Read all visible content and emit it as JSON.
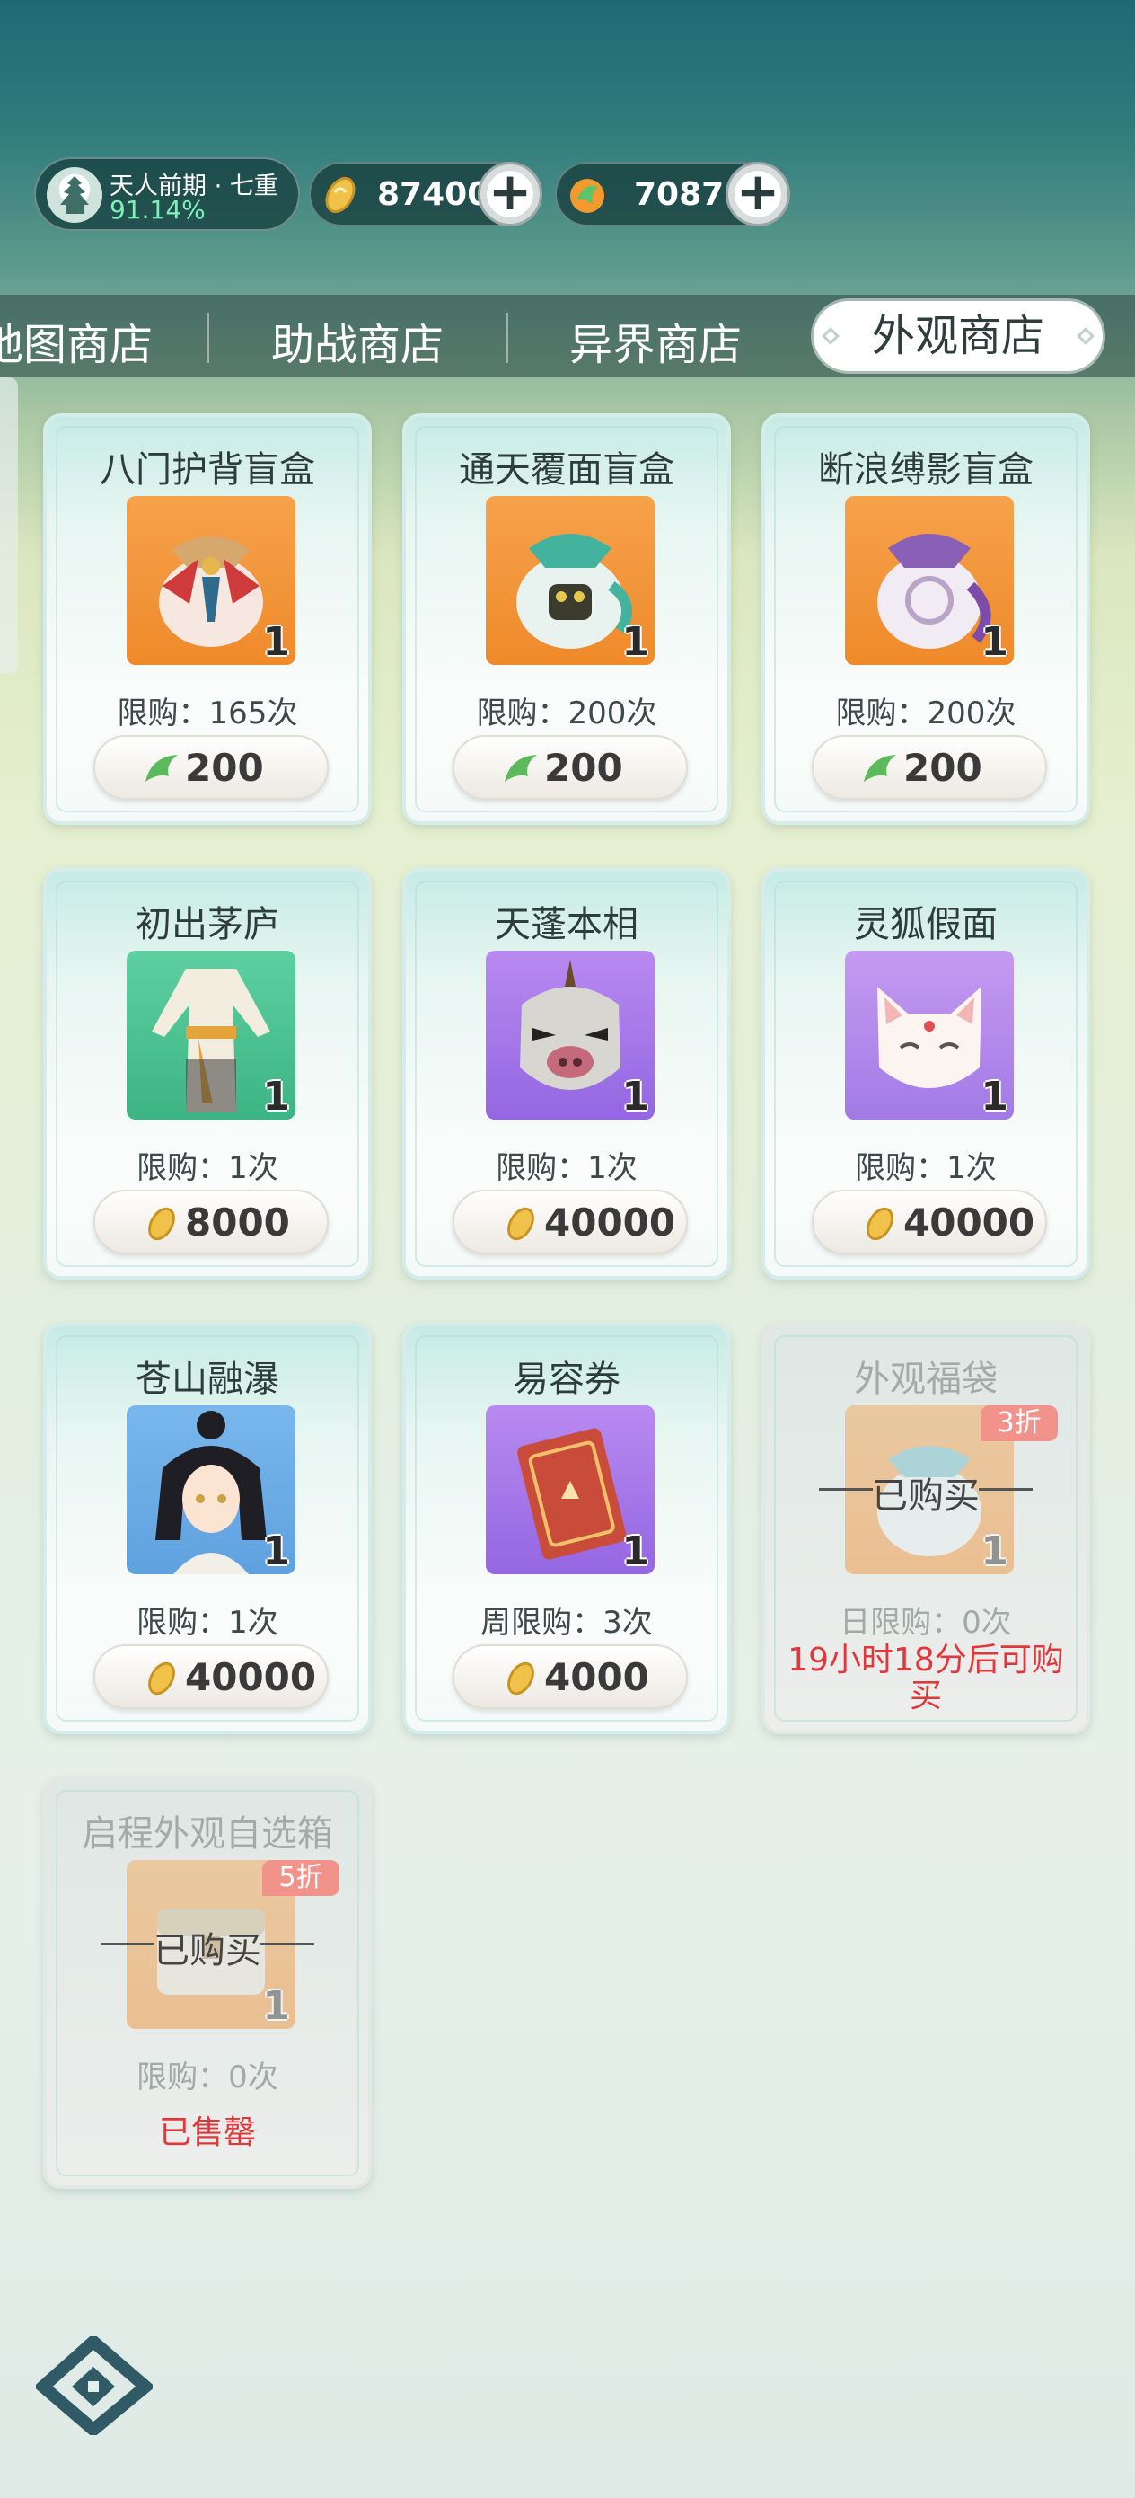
{
  "player": {
    "rank_title": "天人前期 · 七重",
    "progress": "91.14%"
  },
  "currencies": [
    {
      "name": "coin",
      "amount": "87400",
      "plus": "+"
    },
    {
      "name": "jade",
      "amount": "7087",
      "plus": "+"
    }
  ],
  "tabs": [
    {
      "label": "地图商店"
    },
    {
      "label": "助战商店"
    },
    {
      "label": "异界商店"
    },
    {
      "label": "外观商店",
      "active": true
    }
  ],
  "items": [
    {
      "name": "八门护背盲盒",
      "qty": "1",
      "limit": "限购：165次",
      "price": "200",
      "currency": "jade"
    },
    {
      "name": "通天覆面盲盒",
      "qty": "1",
      "limit": "限购：200次",
      "price": "200",
      "currency": "jade"
    },
    {
      "name": "断浪缚影盲盒",
      "qty": "1",
      "limit": "限购：200次",
      "price": "200",
      "currency": "jade"
    },
    {
      "name": "初出茅庐",
      "qty": "1",
      "limit": "限购：1次",
      "price": "8000",
      "currency": "coin"
    },
    {
      "name": "天蓬本相",
      "qty": "1",
      "limit": "限购：1次",
      "price": "40000",
      "currency": "coin"
    },
    {
      "name": "灵狐假面",
      "qty": "1",
      "limit": "限购：1次",
      "price": "40000",
      "currency": "coin"
    },
    {
      "name": "苍山融瀑",
      "qty": "1",
      "limit": "限购：1次",
      "price": "40000",
      "currency": "coin"
    },
    {
      "name": "易容券",
      "qty": "1",
      "limit": "周限购：3次",
      "price": "4000",
      "currency": "coin"
    },
    {
      "name": "外观福袋",
      "qty": "1",
      "limit": "日限购：0次",
      "discount": "3折",
      "status": "已购买",
      "notice": "19小时18分后可购买"
    },
    {
      "name": "启程外观自选箱",
      "qty": "1",
      "limit": "限购：0次",
      "discount": "5折",
      "status": "已购买",
      "notice": "已售罄"
    }
  ],
  "colors": {
    "accent_red": "#e1373a",
    "tab_active_bg": "#ffffff",
    "progress_green": "#7ff0b8"
  },
  "icons": {
    "coin": "gold-ingot-icon",
    "jade": "jade-leaf-icon",
    "plus": "plus-icon",
    "logo": "game-logo-icon"
  }
}
